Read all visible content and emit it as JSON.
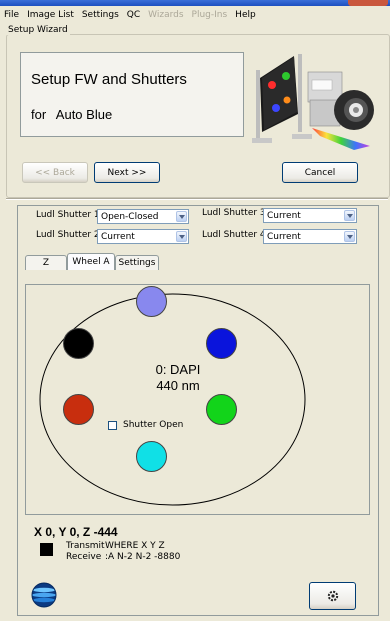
{
  "menu": {
    "items": [
      {
        "label": "File",
        "enabled": true
      },
      {
        "label": "Image List",
        "enabled": true
      },
      {
        "label": "Settings",
        "enabled": true
      },
      {
        "label": "QC",
        "enabled": true
      },
      {
        "label": "Wizards",
        "enabled": false
      },
      {
        "label": "Plug-Ins",
        "enabled": false
      },
      {
        "label": "Help",
        "enabled": true
      }
    ]
  },
  "wizard": {
    "group_label": "Setup Wizard",
    "title": "Setup FW and Shutters",
    "for_label": "for",
    "for_value": "Auto Blue"
  },
  "buttons": {
    "back": "<< Back",
    "next": "Next >>",
    "cancel": "Cancel"
  },
  "shutters": [
    {
      "label": "Ludl Shutter 1",
      "value": "Open-Closed"
    },
    {
      "label": "Ludl Shutter 2",
      "value": "Current"
    },
    {
      "label": "Ludl Shutter 3",
      "value": "Current"
    },
    {
      "label": "Ludl Shutter 4",
      "value": "Current"
    }
  ],
  "tabs": [
    {
      "label": "Z",
      "active": false
    },
    {
      "label": "Wheel A",
      "active": true
    },
    {
      "label": "Settings",
      "active": false
    }
  ],
  "wheel": {
    "current_position": "0: DAPI",
    "current_wavelength": "440 nm",
    "shutter_open_label": "Shutter Open",
    "shutter_open_checked": false,
    "filters": [
      {
        "name": "filter-top",
        "color": "#8888ee"
      },
      {
        "name": "filter-upper-right",
        "color": "#0a14dc"
      },
      {
        "name": "filter-lower-right",
        "color": "#12d41a"
      },
      {
        "name": "filter-bottom",
        "color": "#10e0e6"
      },
      {
        "name": "filter-lower-left",
        "color": "#c82e0e"
      },
      {
        "name": "filter-upper-left",
        "color": "#000000"
      }
    ]
  },
  "status": {
    "position": "X 0, Y 0, Z -444",
    "transmit_label": "Transmit",
    "transmit_value": "WHERE X Y Z",
    "receive_label": "Receive",
    "receive_value": ":A N-2 N-2 -8880"
  },
  "icons": {
    "logo": "globe-logo-icon",
    "action": "gear-icon"
  }
}
